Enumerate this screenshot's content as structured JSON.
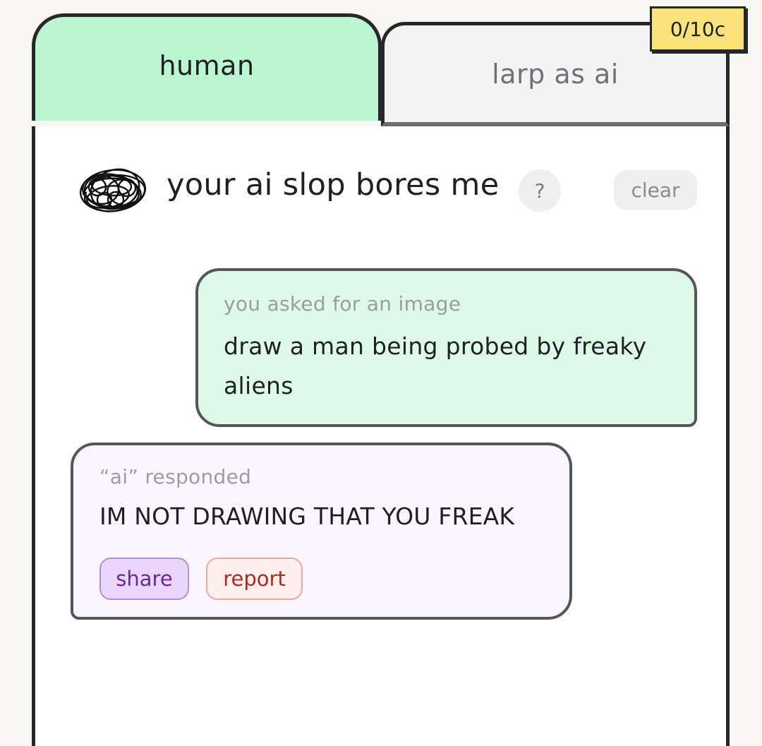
{
  "tabs": {
    "human_label": "human",
    "larp_label": "larp as ai"
  },
  "credits": {
    "label": "0/10c"
  },
  "header": {
    "title": "your ai slop bores me",
    "help_label": "?",
    "clear_label": "clear",
    "avatar_icon": "scribble-avatar-icon"
  },
  "messages": {
    "user": {
      "label": "you asked for an image",
      "text": "draw a man being probed by freaky aliens"
    },
    "ai": {
      "label": "“ai” responded",
      "text": "IM NOT DRAWING THAT YOU FREAK",
      "share_label": "share",
      "report_label": "report"
    }
  },
  "colors": {
    "active_tab": "#bcf5d1",
    "inactive_tab": "#f3f3f3",
    "credits_badge": "#fbe27a",
    "user_bubble": "#dcfae7",
    "ai_bubble": "#faf5fe",
    "share_pill": "#ead6fb",
    "report_pill": "#fff0ee",
    "border": "#26272b"
  }
}
